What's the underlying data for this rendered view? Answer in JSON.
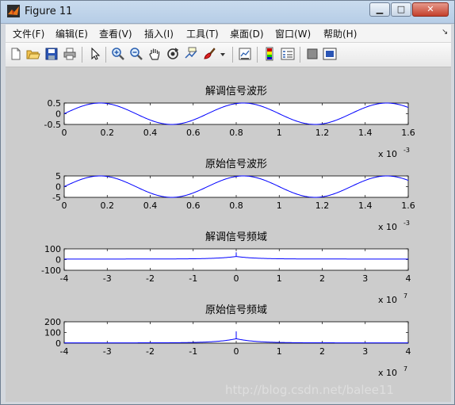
{
  "window": {
    "title": "Figure 11"
  },
  "titlebar_buttons": {
    "minimize": "▁",
    "maximize": "□",
    "close": "✕"
  },
  "menu": [
    "文件(F)",
    "编辑(E)",
    "查看(V)",
    "插入(I)",
    "工具(T)",
    "桌面(D)",
    "窗口(W)",
    "帮助(H)"
  ],
  "toolbar_icons": [
    "new-figure-icon",
    "open-file-icon",
    "save-icon",
    "print-icon",
    "edit-plot-arrow-icon",
    "zoom-in-icon",
    "zoom-out-icon",
    "pan-hand-icon",
    "rotate-3d-icon",
    "data-cursor-icon",
    "brush-icon",
    "brush-dropdown-icon",
    "link-plot-icon",
    "insert-colorbar-icon",
    "insert-legend-icon",
    "hide-plot-tools-icon",
    "show-plot-tools-icon"
  ],
  "watermark": "http://blog.csdn.net/balee11",
  "chart_data": [
    {
      "type": "line",
      "title": "解调信号波形",
      "xlim": [
        0,
        0.0016
      ],
      "ylim": [
        -0.5,
        0.5
      ],
      "xtick_labels": [
        "0",
        "0.2",
        "0.4",
        "0.6",
        "0.8",
        "1",
        "1.2",
        "1.4",
        "1.6"
      ],
      "ytick_labels": [
        "0.5",
        "0",
        "-0.5"
      ],
      "x_multiplier": "x 10",
      "x_multiplier_exp": "-3",
      "series": [
        {
          "color": "#0000ff",
          "amplitude": 0.5,
          "frequency_hz": 1500
        }
      ]
    },
    {
      "type": "line",
      "title": "原始信号波形",
      "xlim": [
        0,
        0.0016
      ],
      "ylim": [
        -5,
        5
      ],
      "xtick_labels": [
        "0",
        "0.2",
        "0.4",
        "0.6",
        "0.8",
        "1",
        "1.2",
        "1.4",
        "1.6"
      ],
      "ytick_labels": [
        "5",
        "0",
        "-5"
      ],
      "x_multiplier": "x 10",
      "x_multiplier_exp": "-3",
      "series": [
        {
          "color": "#0000ff",
          "amplitude": 5,
          "frequency_hz": 1500
        }
      ]
    },
    {
      "type": "line",
      "title": "解调信号频域",
      "xlim": [
        -40000000,
        40000000
      ],
      "ylim": [
        -100,
        100
      ],
      "xtick_labels": [
        "-4",
        "-3",
        "-2",
        "-1",
        "0",
        "1",
        "2",
        "3",
        "4"
      ],
      "ytick_labels": [
        "100",
        "0",
        "-100"
      ],
      "x_multiplier": "x 10",
      "x_multiplier_exp": "7",
      "series": [
        {
          "color": "#0000ff",
          "baseline": 5,
          "peak": 68,
          "peak_x": 0
        }
      ]
    },
    {
      "type": "line",
      "title": "原始信号频域",
      "xlim": [
        -40000000,
        40000000
      ],
      "ylim": [
        0,
        200
      ],
      "xtick_labels": [
        "-4",
        "-3",
        "-2",
        "-1",
        "0",
        "1",
        "2",
        "3",
        "4"
      ],
      "ytick_labels": [
        "200",
        "100",
        "0"
      ],
      "x_multiplier": "x 10",
      "x_multiplier_exp": "7",
      "series": [
        {
          "color": "#0000ff",
          "baseline": 3,
          "peak": 110,
          "peak_x": 0
        }
      ]
    }
  ]
}
